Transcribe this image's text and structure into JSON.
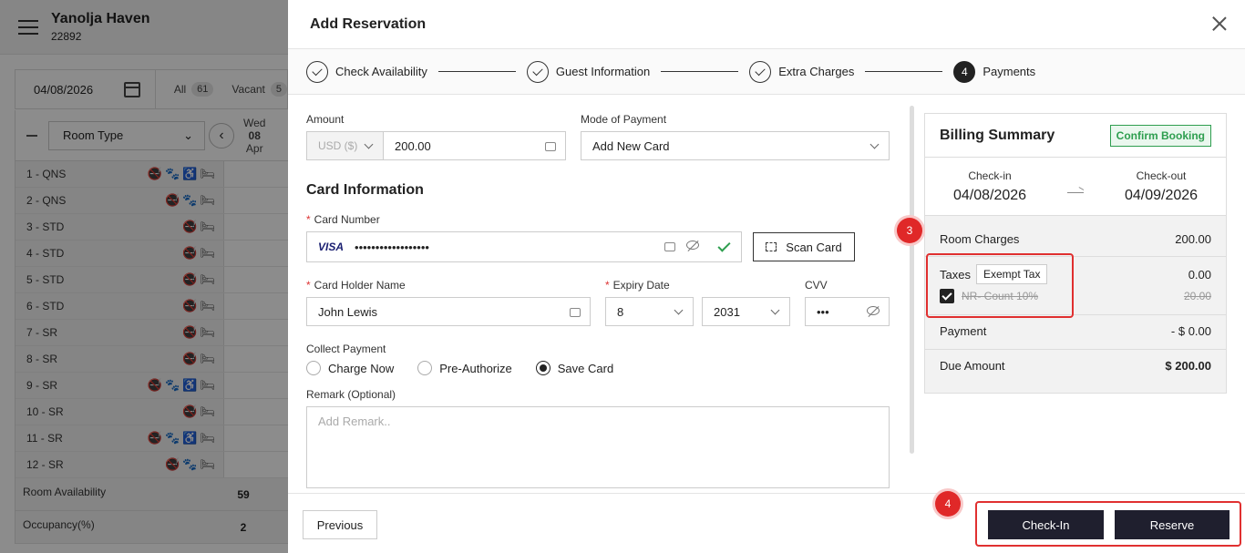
{
  "app": {
    "hotel_name": "Yanolja Haven",
    "hotel_code": "22892"
  },
  "toolbar": {
    "date": "04/08/2026",
    "filter_all": "All",
    "filter_all_count": "61",
    "filter_vacant": "Vacant",
    "filter_vacant_count": "5"
  },
  "grid": {
    "room_type_label": "Room Type",
    "day": {
      "weekday": "Wed",
      "date": "08",
      "month": "Apr"
    },
    "rooms": [
      {
        "name": "1 - QNS",
        "icons": "🚭🐾♿🛏"
      },
      {
        "name": "2 - QNS",
        "icons": "🚭🐾🛏"
      },
      {
        "name": "3 - STD",
        "icons": "🚭🛏"
      },
      {
        "name": "4 - STD",
        "icons": "🚭🛏"
      },
      {
        "name": "5 - STD",
        "icons": "🚭🛏"
      },
      {
        "name": "6 - STD",
        "icons": "🚭🛏"
      },
      {
        "name": "7 - SR",
        "icons": "🚭🛏"
      },
      {
        "name": "8 - SR",
        "icons": "🚭🛏"
      },
      {
        "name": "9 - SR",
        "icons": "🚭🐾♿🛏"
      },
      {
        "name": "10 - SR",
        "icons": "🚭🛏"
      },
      {
        "name": "11 - SR",
        "icons": "🚭🐾♿🛏"
      },
      {
        "name": "12 - SR",
        "icons": "🚭🐾🛏"
      }
    ],
    "room_availability_label": "Room Availability",
    "room_availability_value": "59",
    "occupancy_label": "Occupancy(%)",
    "occupancy_value": "2"
  },
  "modal": {
    "title": "Add Reservation",
    "steps": [
      {
        "label": "Check Availability",
        "state": "done"
      },
      {
        "label": "Guest Information",
        "state": "done"
      },
      {
        "label": "Extra Charges",
        "state": "done"
      },
      {
        "label": "Payments",
        "state": "active",
        "number": "4"
      }
    ],
    "amount_label": "Amount",
    "currency": "USD ($)",
    "amount_value": "200.00",
    "mode_label": "Mode of Payment",
    "mode_value": "Add New Card",
    "card_section_title": "Card Information",
    "card_number_label": "Card Number",
    "card_brand": "VISA",
    "card_number_masked": "••••••••••••••••••",
    "scan_card_label": "Scan Card",
    "holder_label": "Card Holder Name",
    "holder_value": "John Lewis",
    "expiry_label": "Expiry Date",
    "expiry_month": "8",
    "expiry_year": "2031",
    "cvv_label": "CVV",
    "cvv_value": "•••",
    "collect_label": "Collect Payment",
    "collect_options": [
      "Charge Now",
      "Pre-Authorize",
      "Save Card"
    ],
    "collect_selected": "Save Card",
    "remark_label": "Remark (Optional)",
    "remark_placeholder": "Add Remark..",
    "previous_label": "Previous",
    "checkin_label": "Check-In",
    "reserve_label": "Reserve"
  },
  "billing": {
    "title": "Billing Summary",
    "badge": "Confirm Booking",
    "checkin_label": "Check-in",
    "checkin_date": "04/08/2026",
    "checkout_label": "Check-out",
    "checkout_date": "04/09/2026",
    "room_charges_label": "Room Charges",
    "room_charges_value": "200.00",
    "taxes_label": "Taxes",
    "exempt_label": "Exempt Tax",
    "taxes_value": "0.00",
    "tax_item_label": "NR- Count 10%",
    "tax_item_value": "20.00",
    "payment_label": "Payment",
    "payment_value": "- $ 0.00",
    "due_label": "Due Amount",
    "due_value": "$ 200.00"
  },
  "annotations": {
    "tax_marker": "3",
    "actions_marker": "4"
  },
  "colors": {
    "accent_dark": "#1f1f2e",
    "confirm_green": "#2e9e4f",
    "annotation_red": "#e02828"
  }
}
